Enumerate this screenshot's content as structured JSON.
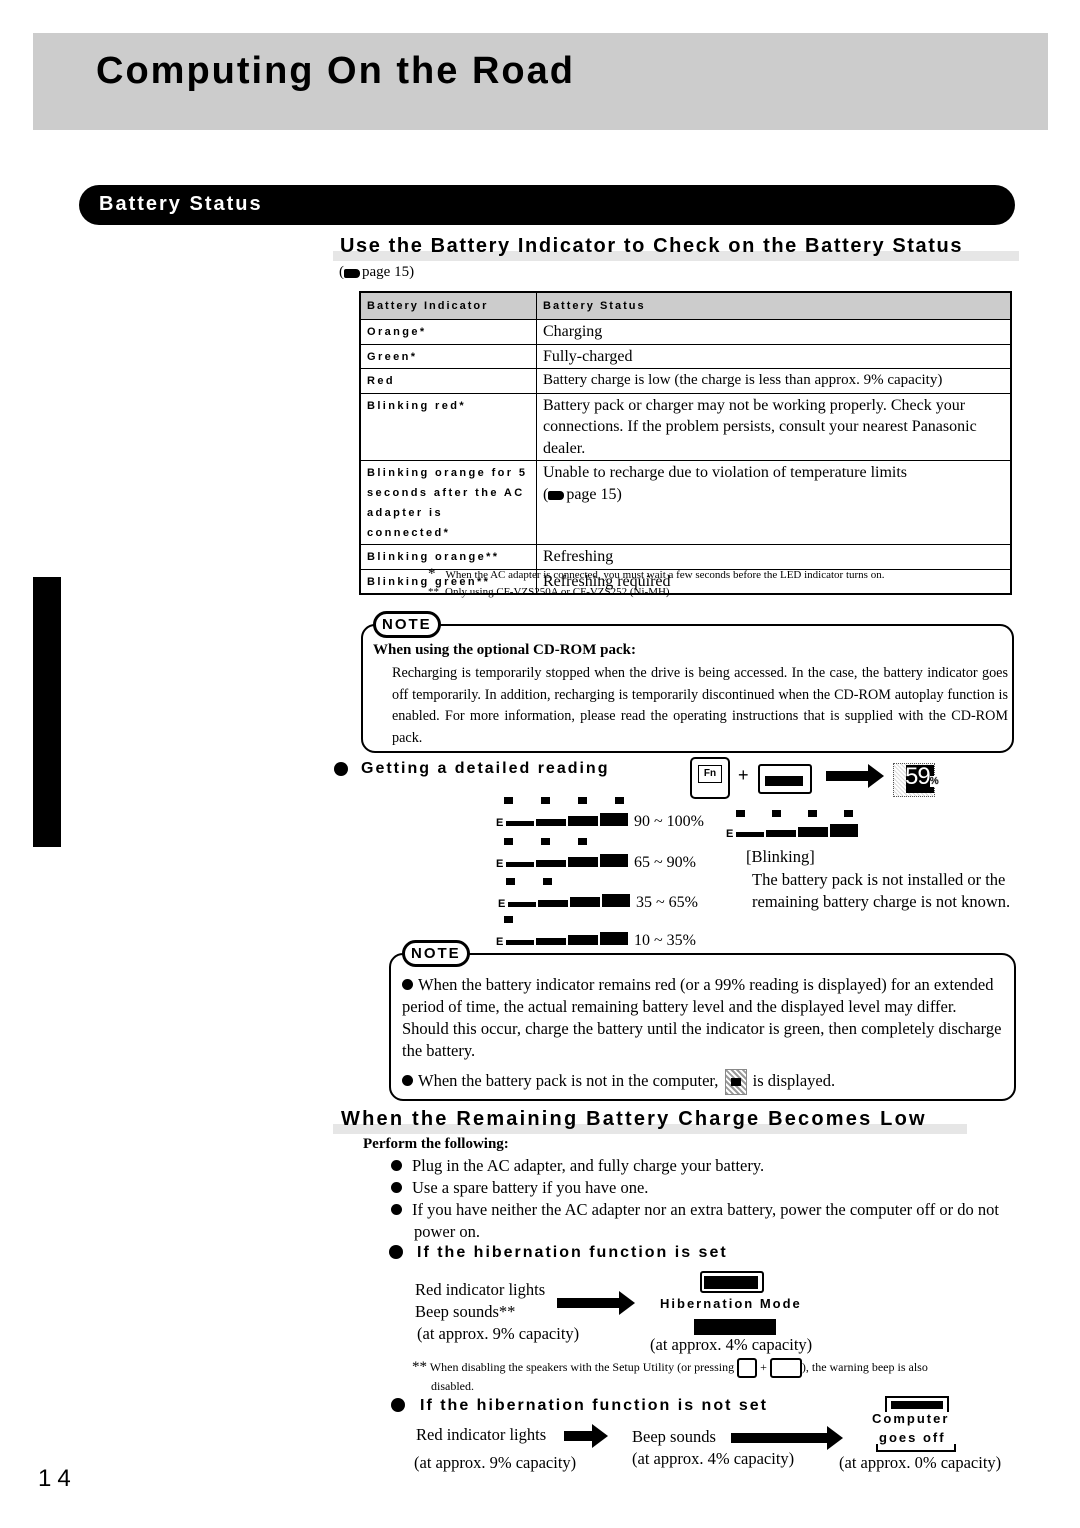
{
  "header": {
    "title": "Computing On the Road"
  },
  "section": {
    "title": "Battery Status"
  },
  "indicator_section": {
    "heading": "Use the Battery Indicator to Check on the Battery Status",
    "page_ref": "page 15",
    "table": {
      "headers": [
        "Battery Indicator",
        "Battery Status"
      ],
      "rows": [
        {
          "indicator": "Orange*",
          "status": "Charging"
        },
        {
          "indicator": "Green*",
          "status": "Fully-charged"
        },
        {
          "indicator": "Red",
          "status": "Battery charge is low (the charge is less than  approx. 9% capacity)"
        },
        {
          "indicator": "Blinking red*",
          "status": "Battery pack or charger may not be working properly. Check your connections.  If the problem persists, consult your nearest Panasonic dealer."
        },
        {
          "indicator": "Blinking orange for 5 seconds after the AC adapter is connected*",
          "status": "Unable to recharge due to violation of temperature limits",
          "page_ref": "page 15"
        },
        {
          "indicator": "Blinking orange**",
          "status": "Refreshing"
        },
        {
          "indicator": "Blinking green**",
          "status": "Refreshing required"
        }
      ]
    },
    "footnotes": [
      {
        "mark": "*",
        "text": "When the AC adapter is connected, you must wait a few seconds before the LED indicator turns on."
      },
      {
        "mark": "**",
        "text": "Only  using  CF-VZS250A or CF-VZS252 (Ni-MH)."
      }
    ],
    "note1": {
      "badge": "NOTE",
      "heading": "When using the optional CD-ROM pack:",
      "text": "Recharging is temporarily stopped when the drive is being accessed. In the case, the battery indicator goes off temporarily. In addition, recharging is temporarily discontinued when the CD-ROM autoplay function is enabled. For more information, please read the operating instructions that is supplied with the CD-ROM pack."
    }
  },
  "detailed_reading": {
    "heading": "Getting a detailed reading",
    "key_fn": "Fn",
    "plus": "+",
    "display_value": "59",
    "display_unit": "%",
    "levels": [
      {
        "label": "90 ~ 100%",
        "leds": 4
      },
      {
        "label": "65 ~ 90%",
        "leds": 3
      },
      {
        "label": "35 ~ 65%",
        "leds": 2
      },
      {
        "label": "10 ~ 35%",
        "leds": 1
      }
    ],
    "blinking_label": "[Blinking]",
    "blinking_text": "The battery pack is not installed or the remaining battery charge is not known.",
    "note2": {
      "badge": "NOTE",
      "bullets": [
        "When the battery indicator remains red (or a 99% reading is displayed) for an extended period of time, the actual remaining battery level and the displayed level may differ. Should this occur, charge the battery until the indicator is green, then completely discharge the battery.",
        "When the battery pack is not in the computer,"
      ],
      "bullet2_suffix": "is displayed."
    }
  },
  "low_charge": {
    "heading": "When the Remaining Battery Charge Becomes Low",
    "perform": "Perform the following:",
    "bullets": [
      "Plug in the AC adapter, and fully charge your battery.",
      "Use a spare battery if you have one.",
      "If you have neither the AC adapter nor an extra battery, power the computer off or do not power on."
    ],
    "hibernation_set": {
      "heading": "If the hibernation function is set",
      "line1": "Red indicator lights",
      "line2": "Beep sounds**",
      "line3": "(at approx. 9% capacity)",
      "result_label": "Hibernation  Mode",
      "result_capacity": "(at approx. 4% capacity)"
    },
    "footnote": {
      "mark": "**",
      "text_before": "When disabling the speakers with  the  Setup Utility (or pressing",
      "plus": "+",
      "text_after": "), the  warning beep is also",
      "text_line2": "disabled."
    },
    "hibernation_not_set": {
      "heading": "If the hibernation function is not set",
      "step1": "Red indicator lights",
      "step1_capacity": "(at approx. 9% capacity)",
      "step2": "Beep sounds",
      "step2_capacity": "(at approx. 4% capacity)",
      "step3_line1": "Computer",
      "step3_line2": "goes off",
      "step3_capacity": "(at approx. 0% capacity)"
    }
  },
  "footer": {
    "page_number": "14"
  }
}
